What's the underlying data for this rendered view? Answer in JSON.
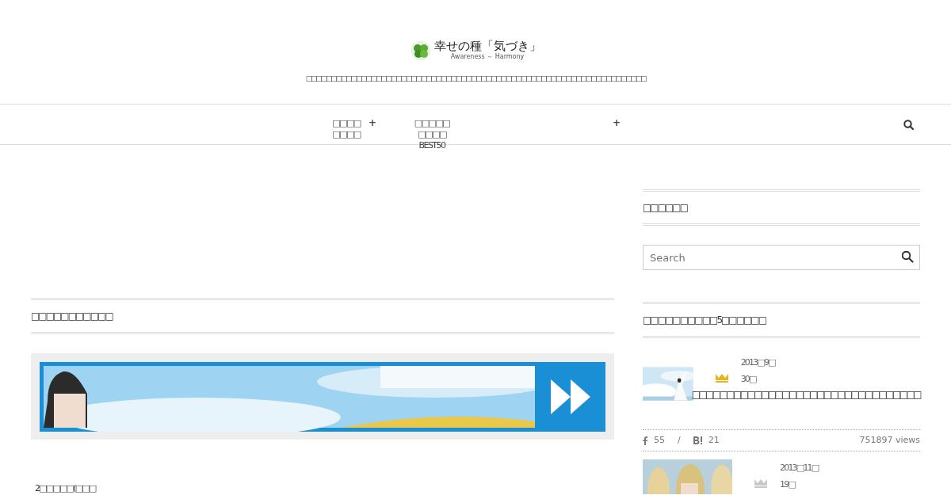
{
  "header": {
    "site_title": "幸せの種「気づき」",
    "site_subtitle": "Awareness ～ Harmony",
    "tagline": "□□□□□□□□□□□□□□□□□□□□□□□□□□□□□□□□□□□□□□□□□□□□□□□□□□□□□□□□□□□□□□□□□□□□"
  },
  "nav": {
    "items": [
      {
        "label": "□□□□□□□□",
        "submenu_icon": "+"
      },
      {
        "label": "□□□□□□□□□ BEST50"
      },
      {
        "submenu_icon": "+"
      }
    ]
  },
  "main": {
    "section_title": "□□□□□□□□□□□",
    "body_text": "2□□□□□(□□□"
  },
  "sidebar": {
    "search_widget": {
      "title": "□□□□□□",
      "placeholder": "Search"
    },
    "ranking": {
      "title": "□□□□□□□□□□5□□□□□□",
      "items": [
        {
          "date": "2013□9□",
          "day": "30□",
          "color": "#e6b422",
          "title": "□□□□□□□□□□□□□□□□□□□□□□□□□□□□□□□□□",
          "facebook": "55",
          "separator": "/",
          "hatena": "21",
          "views": "751897 views"
        },
        {
          "date": "2013□11□",
          "day": "19□",
          "color": "#c8c8c8"
        }
      ]
    }
  }
}
